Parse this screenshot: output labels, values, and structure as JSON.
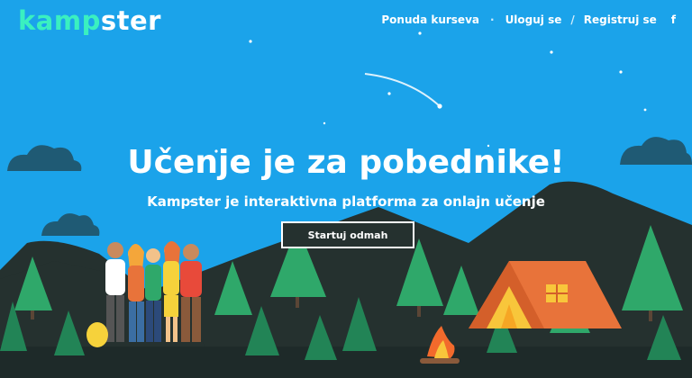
{
  "brand": {
    "logo_part1": "kamp",
    "logo_part2": "ster"
  },
  "nav": {
    "courses": "Ponuda kurseva",
    "login": "Uloguj se",
    "register": "Registruj se",
    "separator_dot": "·",
    "separator_slash": "/",
    "facebook_icon": "f"
  },
  "hero": {
    "title": "Učenje je za pobednike!",
    "subtitle": "Kampster je interaktivna platforma za onlajn učenje",
    "cta": "Startuj odmah"
  },
  "colors": {
    "sky": "#1ba3ea",
    "brand_accent": "#3af0c0",
    "mountain_dark": "#25312f",
    "tree_green": "#2fa86a",
    "tent_orange": "#e8733a"
  }
}
